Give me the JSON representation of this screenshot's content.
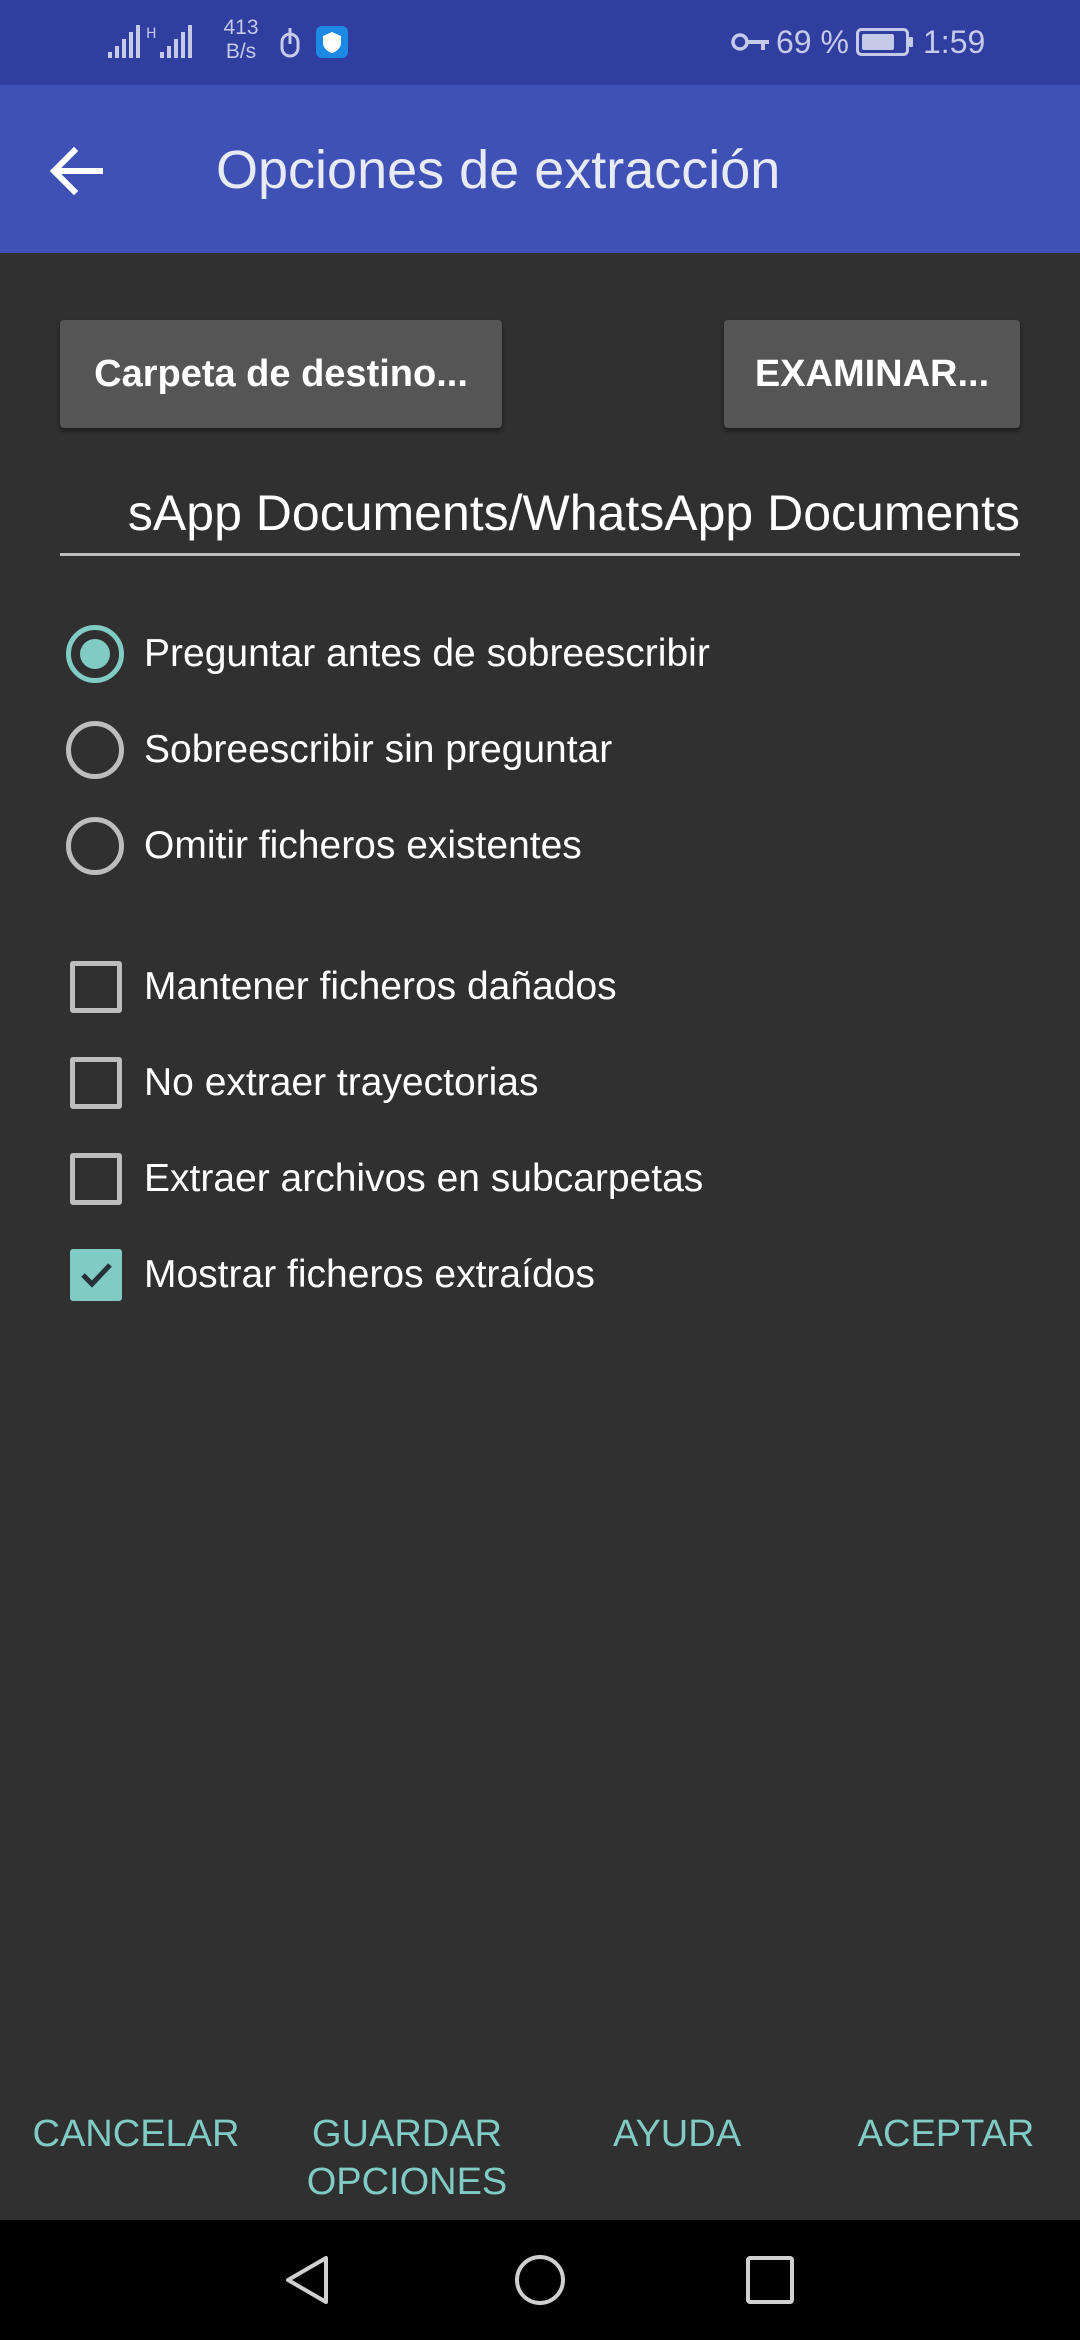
{
  "status_bar": {
    "speed_value": "413",
    "speed_unit": "B/s",
    "battery_percent": "69 %",
    "time": "1:59",
    "icons": [
      "signal-icon",
      "wifi-hotspot-icon",
      "usb-debug-icon",
      "shield-icon",
      "vpn-key-icon",
      "battery-icon"
    ]
  },
  "app_bar": {
    "title": "Opciones de extracción",
    "back_icon": "arrow-back-icon"
  },
  "destination": {
    "button_label": "Carpeta de destino...",
    "browse_label": "EXAMINAR...",
    "path_value": "sApp Documents/WhatsApp Documents"
  },
  "overwrite_options": [
    {
      "label": "Preguntar antes de sobreescribir",
      "checked": true
    },
    {
      "label": "Sobreescribir sin preguntar",
      "checked": false
    },
    {
      "label": "Omitir ficheros existentes",
      "checked": false
    }
  ],
  "checkboxes": [
    {
      "label": "Mantener ficheros dañados",
      "checked": false
    },
    {
      "label": "No extraer trayectorias",
      "checked": false
    },
    {
      "label": "Extraer archivos en subcarpetas",
      "checked": false
    },
    {
      "label": "Mostrar ficheros extraídos",
      "checked": true
    }
  ],
  "footer": {
    "cancel": "CANCELAR",
    "save": "GUARDAR OPCIONES",
    "help": "AYUDA",
    "accept": "ACEPTAR"
  },
  "colors": {
    "status_bar": "#303f9f",
    "app_bar": "#3f51b5",
    "background": "#303030",
    "accent": "#80cbc4",
    "button": "#555555"
  }
}
